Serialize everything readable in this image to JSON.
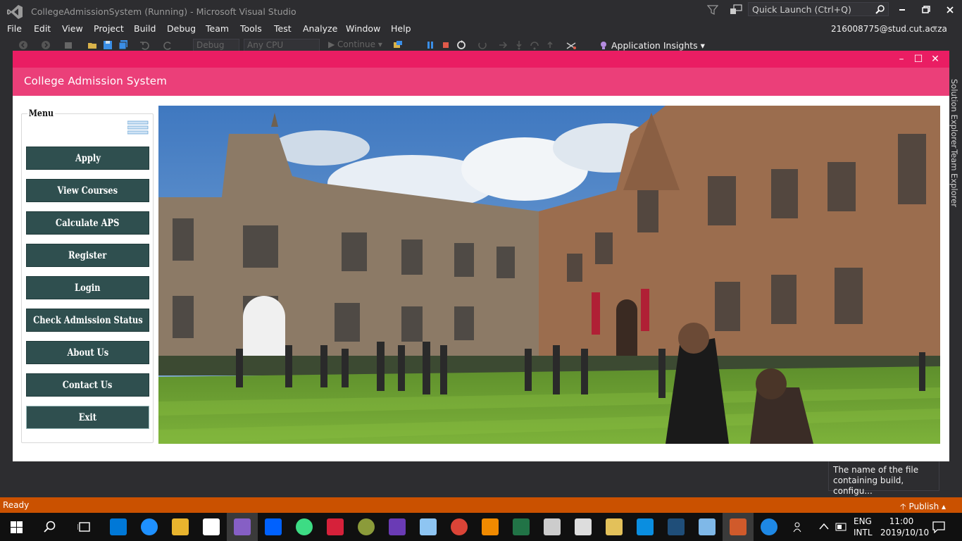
{
  "vs": {
    "window_title": "CollegeAdmissionSystem (Running) - Microsoft Visual Studio",
    "quick_launch_placeholder": "Quick Launch (Ctrl+Q)",
    "menus": [
      "File",
      "Edit",
      "View",
      "Project",
      "Build",
      "Debug",
      "Team",
      "Tools",
      "Test",
      "Analyze",
      "Window",
      "Help"
    ],
    "account": "216008775@stud.cut.ac.za",
    "toolbar": {
      "config": "Debug",
      "platform": "Any CPU",
      "continue_label": "Continue",
      "insights_label": "Application Insights"
    },
    "side_tabs": [
      "Solution Explorer",
      "Team Explorer"
    ],
    "tooltip": "The name of the file containing build, configu...",
    "status": "Ready",
    "publish": "Publish",
    "accent": "#ca5100"
  },
  "taskbar": {
    "lang": [
      "ENG",
      "INTL"
    ],
    "time": "11:00",
    "date": "2019/10/10"
  },
  "app": {
    "header_title": "College Admission System",
    "menu_legend": "Menu",
    "menu_buttons": [
      "Apply",
      "View Courses",
      "Calculate APS",
      "Register",
      "Login",
      "Check Admission Status",
      "About Us",
      "Contact Us",
      "Exit"
    ],
    "titlebar_color": "#ea1d63",
    "header_color": "#eb3f79",
    "button_color": "#2f4f4f"
  }
}
